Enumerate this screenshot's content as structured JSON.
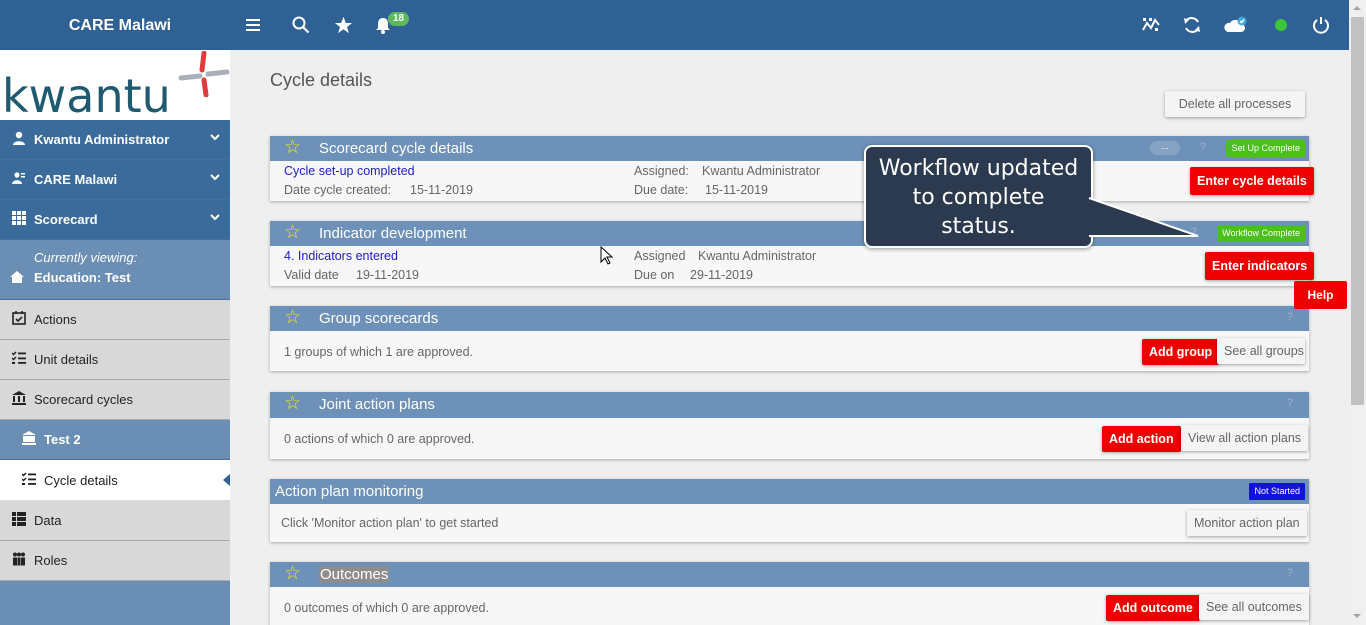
{
  "topbar": {
    "brand": "CARE Malawi",
    "notification_count": "18",
    "icons": [
      "menu-icon",
      "search-icon",
      "star-icon",
      "bell-icon",
      "analytics-icon",
      "sync-icon",
      "cloud-check-icon",
      "status-dot",
      "power-icon"
    ]
  },
  "sidebar": {
    "logo_text": "kwantu",
    "items": [
      {
        "label": "Kwantu Administrator"
      },
      {
        "label": "CARE Malawi"
      },
      {
        "label": "Scorecard"
      },
      {
        "label": "Actions"
      },
      {
        "label": "Unit details"
      },
      {
        "label": "Scorecard cycles"
      },
      {
        "label": "Test 2"
      },
      {
        "label": "Cycle details"
      },
      {
        "label": "Data"
      },
      {
        "label": "Roles"
      }
    ],
    "viewing_label": "Currently viewing:",
    "viewing_value": "Education: Test"
  },
  "main": {
    "title": "Cycle details",
    "delete_all": "Delete all processes",
    "panels": [
      {
        "title": "Scorecard cycle details",
        "status": "Set Up Complete",
        "dots": "...",
        "help": "?",
        "link": "Cycle set-up completed",
        "date_label": "Date cycle created:",
        "date_value": "15-11-2019",
        "assigned_label": "Assigned:",
        "assigned_value": "Kwantu Administrator",
        "due_label": "Due date:",
        "due_value": "15-11-2019",
        "button": "Enter cycle details"
      },
      {
        "title": "Indicator development",
        "status": "Workflow Complete",
        "help": "?",
        "link": "4. Indicators entered",
        "date_label": "Valid date",
        "date_value": "19-11-2019",
        "assigned_label": "Assigned",
        "assigned_value": "Kwantu Administrator",
        "due_label": "Due on",
        "due_value": "29-11-2019",
        "button": "Enter indicators"
      },
      {
        "title": "Group scorecards",
        "help": "?",
        "text": "1 groups of which 1 are approved.",
        "button": "Add group",
        "button2": "See all groups"
      },
      {
        "title": "Joint action plans",
        "help": "?",
        "text": "0 actions of which 0 are approved.",
        "button": "Add action",
        "button2": "View all action plans"
      },
      {
        "title": "Action plan monitoring",
        "status": "Not Started",
        "text": "Click 'Monitor action plan' to get started",
        "button2": "Monitor action plan"
      },
      {
        "title": "Outcomes",
        "help": "?",
        "text": "0 outcomes of which 0 are approved.",
        "button": "Add outcome",
        "button2": "See all outcomes"
      }
    ]
  },
  "callout": {
    "line1": "Workflow updated",
    "line2": "to complete",
    "line3": "status."
  },
  "help_button": "Help",
  "colors": {
    "topbar": "#2f6195",
    "sidebar": "#6b8fb4",
    "panel_header": "#6d91b8",
    "danger": "#ee0000",
    "complete": "#4bbf20",
    "not_started": "#1212e0",
    "star": "#f3e515"
  }
}
